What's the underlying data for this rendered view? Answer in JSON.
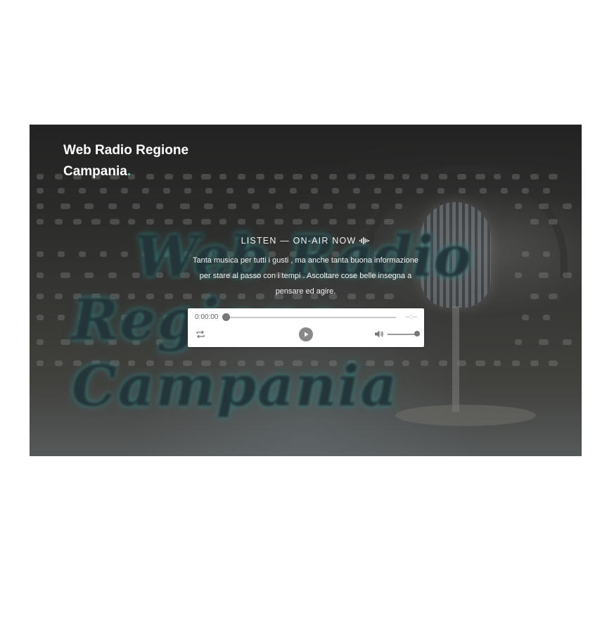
{
  "site": {
    "title_main": "Web Radio Regione Campania",
    "title_dot": "."
  },
  "hero": {
    "background_logo_line1": "Web Radio",
    "background_logo_line2": "Regione Campania",
    "listen_label": "LISTEN — ON-AIR NOW",
    "listen_icon": "audio-wave-icon",
    "description": "Tanta musica per tutti i gusti , ma anche tanta buona informazione per stare al passo con i tempi . Ascoltare cose belle insegna a pensare ed agire."
  },
  "player": {
    "current_time": "0:00:00",
    "duration": "--:--",
    "progress": 0,
    "volume": 1.0,
    "icons": {
      "loop": "loop-icon",
      "play": "play-icon",
      "volume": "volume-icon"
    }
  },
  "colors": {
    "accent": "#5fc7c2",
    "title_text": "#ffffff",
    "player_bg": "#ffffff",
    "player_control": "#888888"
  }
}
